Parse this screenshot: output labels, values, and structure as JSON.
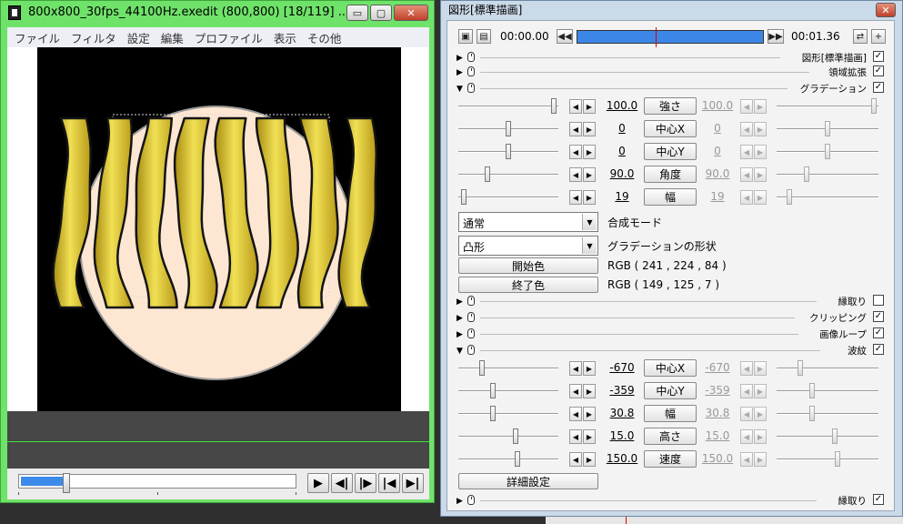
{
  "preview_window": {
    "title": "800x800_30fps_44100Hz.exedit (800,800)  [18/119]  ...",
    "caption_buttons": {
      "minimize": "▭",
      "maximize": "▢",
      "close": "✕"
    },
    "menu": [
      "ファイル",
      "フィルタ",
      "設定",
      "編集",
      "プロファイル",
      "表示",
      "その他"
    ],
    "seek_position": 0.16,
    "transport": [
      "play-icon",
      "prev-frame-icon",
      "next-frame-icon",
      "first-frame-icon",
      "last-frame-icon"
    ],
    "colors": {
      "circle_fill": "#fde6d2",
      "wave_gold": "#e8cf4a",
      "frame_green": "#6fe26a"
    }
  },
  "settings_window": {
    "title": "図形[標準描画]",
    "close": "✕",
    "timeline": {
      "start_time": "00:00.00",
      "end_time": "00:01.36",
      "marker_position": 0.42
    },
    "sections": {
      "standard_draw": {
        "label": "図形[標準描画]",
        "checked": "✓"
      },
      "area_expand": {
        "label": "領域拡張",
        "checked": "✓"
      },
      "gradation": {
        "label": "グラデーション",
        "checked": "✓"
      },
      "border": {
        "label": "縁取り",
        "checked": ""
      },
      "clipping": {
        "label": "クリッピング",
        "checked": "✓"
      },
      "image_loop": {
        "label": "画像ループ",
        "checked": "✓"
      },
      "wave": {
        "label": "波紋",
        "checked": "✓"
      },
      "border2": {
        "label": "縁取り",
        "checked": "✓"
      }
    },
    "gradation_params": [
      {
        "label": "強さ",
        "value": "100.0",
        "end_value": "100.0",
        "pos": 0.98,
        "end_pos": 0.98
      },
      {
        "label": "中心X",
        "value": "0",
        "end_value": "0",
        "pos": 0.5,
        "end_pos": 0.5
      },
      {
        "label": "中心Y",
        "value": "0",
        "end_value": "0",
        "pos": 0.5,
        "end_pos": 0.5
      },
      {
        "label": "角度",
        "value": "90.0",
        "end_value": "90.0",
        "pos": 0.28,
        "end_pos": 0.28
      },
      {
        "label": "幅",
        "value": "19",
        "end_value": "19",
        "pos": 0.03,
        "end_pos": 0.1
      }
    ],
    "blend_mode": {
      "value": "通常",
      "label": "合成モード"
    },
    "gradation_shape": {
      "value": "凸形",
      "label": "グラデーションの形状"
    },
    "start_color": {
      "button": "開始色",
      "value": "RGB ( 241 , 224 , 84 )"
    },
    "end_color": {
      "button": "終了色",
      "value": "RGB ( 149 , 125 , 7 )"
    },
    "wave_params": [
      {
        "label": "中心X",
        "value": "-670",
        "end_value": "-670",
        "pos": 0.22,
        "end_pos": 0.22
      },
      {
        "label": "中心Y",
        "value": "-359",
        "end_value": "-359",
        "pos": 0.34,
        "end_pos": 0.34
      },
      {
        "label": "幅",
        "value": "30.8",
        "end_value": "30.8",
        "pos": 0.34,
        "end_pos": 0.34
      },
      {
        "label": "高さ",
        "value": "15.0",
        "end_value": "15.0",
        "pos": 0.58,
        "end_pos": 0.58
      },
      {
        "label": "速度",
        "value": "150.0",
        "end_value": "150.0",
        "pos": 0.6,
        "end_pos": 0.6
      }
    ],
    "detail_button": "詳細設定"
  }
}
